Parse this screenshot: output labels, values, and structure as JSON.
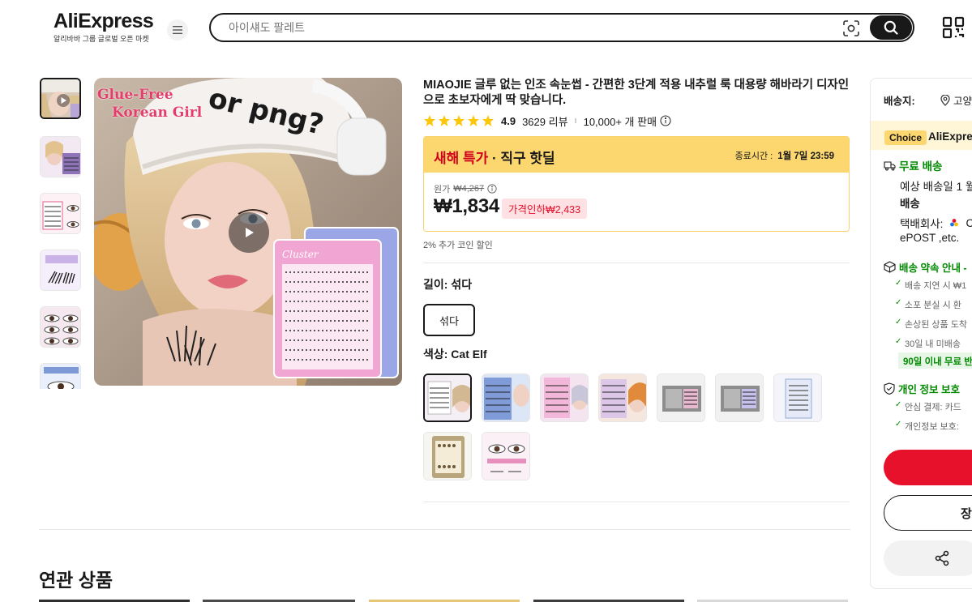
{
  "header": {
    "logo_text": "AliExpress",
    "logo_tagline": "알리바바 그룹 글로벌 오픈 마켓",
    "search_placeholder": "아이섀도 팔레트"
  },
  "gallery": {
    "overlay_line1": "Glue-Free",
    "overlay_line2": "Korean Girl",
    "hat_text": "or png?",
    "pack_label": "Cluster"
  },
  "product": {
    "title": "MIAOJIE 글루 없는 인조 속눈썹 - 간편한 3단계 적용 내추럴 룩 대용량 해바라기 디자인으로 초보자에게 딱 맞습니다.",
    "rating": "4.9",
    "reviews": "3629 리뷰",
    "rating_separator": "ı",
    "sold": "10,000+ 개 판매",
    "rating_stars": 5
  },
  "promo": {
    "name_highlight": "새해 특가",
    "name_rest": " · 직구 핫딜",
    "end_label": "종료시간 :",
    "end_time": "1월 7일 23:59",
    "original_label": "원가",
    "original_price": "₩4,267",
    "price": "₩1,834",
    "price_drop": "가격인하₩2,433",
    "coin_discount": "2% 추가 코인 할인"
  },
  "options": {
    "length_label": "길이: 섞다",
    "length_value": "섞다",
    "color_label": "색상: Cat Elf",
    "swatch_count": 9
  },
  "shipping": {
    "ship_to_label": "배송지:",
    "ship_to_value": "고양",
    "choice_badge": "Choice",
    "choice_text": "AliExpre",
    "free_shipping": "무료 배송",
    "est_line1": "예상 배송일 1 월",
    "est_line2": "배송",
    "carrier_label": "택배회사:",
    "carrier_value": "C",
    "carrier_line2": "ePOST ,etc.",
    "promise_title": "배송 약속 안내 -",
    "promise_items": [
      "배송 지연 시 ₩1",
      "소포 분실 시 환",
      "손상된 상품 도착",
      "30일 내 미배송"
    ],
    "promise_pill": "90일 이내 무료 반",
    "privacy_title": "개인 정보 보호",
    "privacy_items": [
      "안심 결제: 카드",
      "개인정보 보호:"
    ],
    "cart_label": "장"
  },
  "related": {
    "title": "연관 상품"
  },
  "colors": {
    "red": "#e8112b",
    "green": "#018a00",
    "promo_yellow": "#fcd66f"
  }
}
